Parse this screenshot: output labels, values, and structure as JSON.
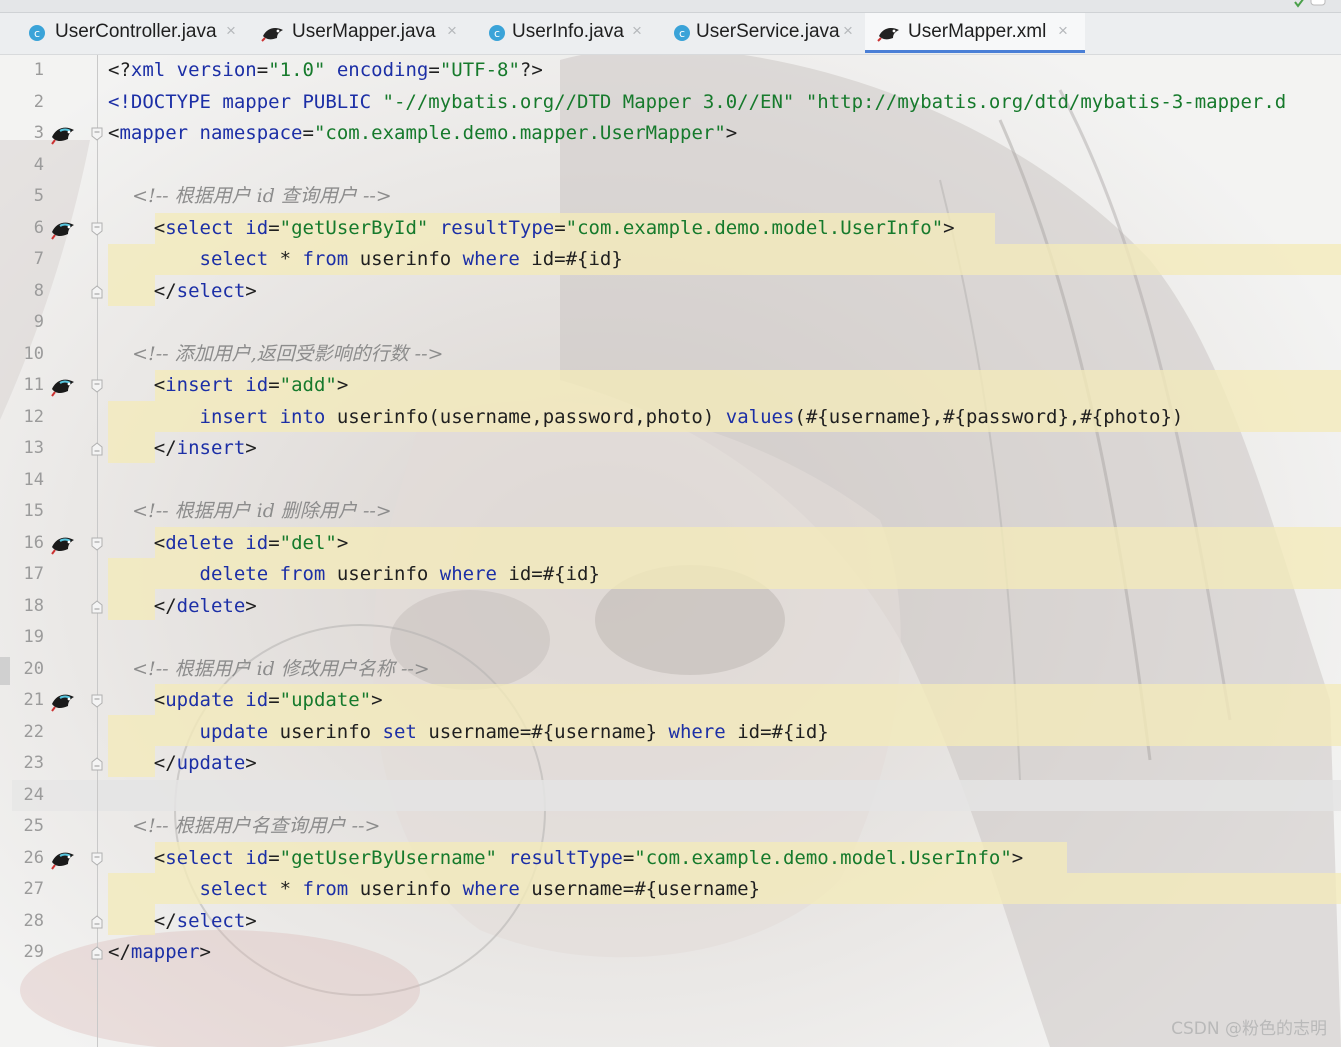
{
  "tabs": [
    {
      "label": "UserController.java",
      "icon": "class-icon",
      "active": false
    },
    {
      "label": "UserMapper.java",
      "icon": "mybatis-bird-icon",
      "active": false
    },
    {
      "label": "UserInfo.java",
      "icon": "class-icon",
      "active": false
    },
    {
      "label": "UserService.java",
      "icon": "class-icon",
      "active": false
    },
    {
      "label": "UserMapper.xml",
      "icon": "mybatis-bird-icon",
      "active": true
    }
  ],
  "close_glyph": "×",
  "colors": {
    "keyword": "#1c2fa6",
    "string": "#167a2c",
    "comment": "#8c8c8c",
    "highlight": "#f3ebba",
    "active_tab_underline": "#4a7fd6"
  },
  "lines": [
    {
      "n": "1",
      "tokens": [
        [
          "p",
          "<?"
        ],
        [
          "k",
          "xml"
        ],
        [
          "p",
          " "
        ],
        [
          "a",
          "version"
        ],
        [
          "p",
          "="
        ],
        [
          "v",
          "\"1.0\""
        ],
        [
          "p",
          " "
        ],
        [
          "a",
          "encoding"
        ],
        [
          "p",
          "="
        ],
        [
          "v",
          "\"UTF-8\""
        ],
        [
          "p",
          "?>"
        ]
      ]
    },
    {
      "n": "2",
      "tokens": [
        [
          "k",
          "<!DOCTYPE mapper PUBLIC "
        ],
        [
          "v",
          "\"-//mybatis.org//DTD Mapper 3.0//EN\""
        ],
        [
          "p",
          " "
        ],
        [
          "v",
          "\"http://mybatis.org/dtd/mybatis-3-mapper.d"
        ]
      ]
    },
    {
      "n": "3",
      "tokens": [
        [
          "p",
          "<"
        ],
        [
          "k",
          "mapper"
        ],
        [
          "p",
          " "
        ],
        [
          "a",
          "namespace"
        ],
        [
          "p",
          "="
        ],
        [
          "v",
          "\"com.example.demo.mapper.UserMapper\""
        ],
        [
          "p",
          ">"
        ]
      ]
    },
    {
      "n": "4",
      "tokens": []
    },
    {
      "n": "5",
      "tokens": [
        [
          "c",
          "    <!-- 根据用户 id 查询用户 -->"
        ]
      ]
    },
    {
      "n": "6",
      "tokens": [
        [
          "p",
          "    <"
        ],
        [
          "k",
          "select"
        ],
        [
          "p",
          " "
        ],
        [
          "a",
          "id"
        ],
        [
          "p",
          "="
        ],
        [
          "v",
          "\"getUserById\""
        ],
        [
          "p",
          " "
        ],
        [
          "a",
          "resultType"
        ],
        [
          "p",
          "="
        ],
        [
          "v",
          "\"com.example.demo.model.UserInfo\""
        ],
        [
          "p",
          ">"
        ]
      ]
    },
    {
      "n": "7",
      "tokens": [
        [
          "p",
          "        "
        ],
        [
          "s",
          "select"
        ],
        [
          "p",
          " * "
        ],
        [
          "s",
          "from"
        ],
        [
          "p",
          " userinfo "
        ],
        [
          "s",
          "where"
        ],
        [
          "p",
          " id=#{id}"
        ]
      ]
    },
    {
      "n": "8",
      "tokens": [
        [
          "p",
          "    </"
        ],
        [
          "k",
          "select"
        ],
        [
          "p",
          ">"
        ]
      ]
    },
    {
      "n": "9",
      "tokens": []
    },
    {
      "n": "10",
      "tokens": [
        [
          "c",
          "    <!-- 添加用户,返回受影响的行数 -->"
        ]
      ]
    },
    {
      "n": "11",
      "tokens": [
        [
          "p",
          "    <"
        ],
        [
          "k",
          "insert"
        ],
        [
          "p",
          " "
        ],
        [
          "a",
          "id"
        ],
        [
          "p",
          "="
        ],
        [
          "v",
          "\"add\""
        ],
        [
          "p",
          ">"
        ]
      ]
    },
    {
      "n": "12",
      "tokens": [
        [
          "p",
          "        "
        ],
        [
          "s",
          "insert"
        ],
        [
          "p",
          " "
        ],
        [
          "s",
          "into"
        ],
        [
          "p",
          " userinfo(username,password,photo) "
        ],
        [
          "s",
          "values"
        ],
        [
          "p",
          "(#{username},#{password},#{photo})"
        ]
      ]
    },
    {
      "n": "13",
      "tokens": [
        [
          "p",
          "    </"
        ],
        [
          "k",
          "insert"
        ],
        [
          "p",
          ">"
        ]
      ]
    },
    {
      "n": "14",
      "tokens": []
    },
    {
      "n": "15",
      "tokens": [
        [
          "c",
          "    <!-- 根据用户 id 删除用户 -->"
        ]
      ]
    },
    {
      "n": "16",
      "tokens": [
        [
          "p",
          "    <"
        ],
        [
          "k",
          "delete"
        ],
        [
          "p",
          " "
        ],
        [
          "a",
          "id"
        ],
        [
          "p",
          "="
        ],
        [
          "v",
          "\"del\""
        ],
        [
          "p",
          ">"
        ]
      ]
    },
    {
      "n": "17",
      "tokens": [
        [
          "p",
          "        "
        ],
        [
          "s",
          "delete"
        ],
        [
          "p",
          " "
        ],
        [
          "s",
          "from"
        ],
        [
          "p",
          " userinfo "
        ],
        [
          "s",
          "where"
        ],
        [
          "p",
          " id=#{id}"
        ]
      ]
    },
    {
      "n": "18",
      "tokens": [
        [
          "p",
          "    </"
        ],
        [
          "k",
          "delete"
        ],
        [
          "p",
          ">"
        ]
      ]
    },
    {
      "n": "19",
      "tokens": []
    },
    {
      "n": "20",
      "tokens": [
        [
          "c",
          "    <!-- 根据用户 id 修改用户名称 -->"
        ]
      ]
    },
    {
      "n": "21",
      "tokens": [
        [
          "p",
          "    <"
        ],
        [
          "k",
          "update"
        ],
        [
          "p",
          " "
        ],
        [
          "a",
          "id"
        ],
        [
          "p",
          "="
        ],
        [
          "v",
          "\"update\""
        ],
        [
          "p",
          ">"
        ]
      ]
    },
    {
      "n": "22",
      "tokens": [
        [
          "p",
          "        "
        ],
        [
          "s",
          "update"
        ],
        [
          "p",
          " userinfo "
        ],
        [
          "s",
          "set"
        ],
        [
          "p",
          " username=#{username} "
        ],
        [
          "s",
          "where"
        ],
        [
          "p",
          " id=#{id}"
        ]
      ]
    },
    {
      "n": "23",
      "tokens": [
        [
          "p",
          "    </"
        ],
        [
          "k",
          "update"
        ],
        [
          "p",
          ">"
        ]
      ]
    },
    {
      "n": "24",
      "tokens": []
    },
    {
      "n": "25",
      "tokens": [
        [
          "c",
          "    <!-- 根据用户名查询用户 -->"
        ]
      ]
    },
    {
      "n": "26",
      "tokens": [
        [
          "p",
          "    <"
        ],
        [
          "k",
          "select"
        ],
        [
          "p",
          " "
        ],
        [
          "a",
          "id"
        ],
        [
          "p",
          "="
        ],
        [
          "v",
          "\"getUserByUsername\""
        ],
        [
          "p",
          " "
        ],
        [
          "a",
          "resultType"
        ],
        [
          "p",
          "="
        ],
        [
          "v",
          "\"com.example.demo.model.UserInfo\""
        ],
        [
          "p",
          ">"
        ]
      ]
    },
    {
      "n": "27",
      "tokens": [
        [
          "p",
          "        "
        ],
        [
          "s",
          "select"
        ],
        [
          "p",
          " * "
        ],
        [
          "s",
          "from"
        ],
        [
          "p",
          " userinfo "
        ],
        [
          "s",
          "where"
        ],
        [
          "p",
          " username=#{username}"
        ]
      ]
    },
    {
      "n": "28",
      "tokens": [
        [
          "p",
          "    </"
        ],
        [
          "k",
          "select"
        ],
        [
          "p",
          ">"
        ]
      ]
    },
    {
      "n": "29",
      "tokens": [
        [
          "p",
          "</"
        ],
        [
          "k",
          "mapper"
        ],
        [
          "p",
          ">"
        ]
      ]
    }
  ],
  "gutter_bird_lines": [
    "3",
    "6",
    "11",
    "16",
    "21",
    "26"
  ],
  "fold_open_lines": [
    "3",
    "6",
    "11",
    "16",
    "21",
    "26"
  ],
  "fold_close_lines": [
    "8",
    "13",
    "18",
    "23",
    "28",
    "29"
  ],
  "watermark": "CSDN @粉色的志明"
}
